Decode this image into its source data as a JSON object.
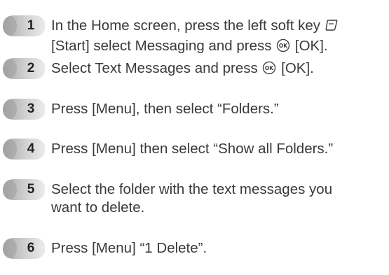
{
  "steps": [
    {
      "number": "1",
      "line1_text": "In the Home screen, press the left soft key",
      "line2_start": "[Start] select Messaging and press",
      "line2_end": "[OK]."
    },
    {
      "number": "2",
      "text_start": "Select Text Messages and press",
      "text_end": "[OK]."
    },
    {
      "number": "3",
      "text": "Press [Menu], then select “Folders.”"
    },
    {
      "number": "4",
      "text": "Press [Menu] then select “Show all Folders.”"
    },
    {
      "number": "5",
      "line1": "Select the folder with the text messages you",
      "line2": "want to delete."
    },
    {
      "number": "6",
      "text": "Press [Menu] “1 Delete”."
    }
  ],
  "colors": {
    "badge_light": "#e6e6e6",
    "badge_dark": "#a8a8a8",
    "text": "#3a3a3a",
    "number": "#222222"
  },
  "icons": {
    "soft_key": "left-soft-key-icon",
    "ok_key": "ok-key-icon"
  }
}
